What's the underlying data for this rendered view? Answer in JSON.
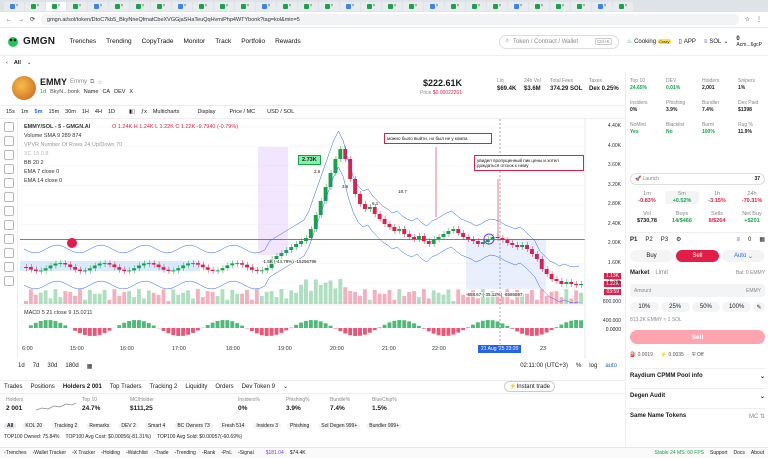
{
  "browser": {
    "url": "gmgn.ai/sol/token/DtoC7kb5_BkyNneQfmatCbeXVGGjaSHaTeuQqHvmiPhp4WTYbonk?tag=kol&min=5",
    "tab_close": "×"
  },
  "nav": {
    "logo": "GMGN",
    "items": [
      "Trenches",
      "Trending",
      "CopyTrade",
      "Monitor",
      "Track",
      "Portfolio",
      "Rewards"
    ],
    "search_placeholder": "Token / Contract / Wallet",
    "search_shortcut": "Ctrl+K",
    "cooking": "Cooking",
    "cooking_badge": "Crazy",
    "app": "APP",
    "chain": "SOL",
    "balance": "0",
    "wallet": "Acm...6gcP"
  },
  "subnav": {
    "filter": "All"
  },
  "token": {
    "symbol": "EMMY",
    "name": "Emmy",
    "age": "1d",
    "creator": "BkyN...bonk",
    "links": [
      "Name",
      "CA",
      "DEV",
      "X"
    ],
    "price_usd": "$222.61K",
    "price_label": "Price",
    "price_sol": "$0.00022261",
    "liq_label": "Liq",
    "liq": "$69.4K",
    "vol_label": "24h Vol",
    "vol": "$3.6M",
    "fees_label": "Total Fees",
    "fees": "374.29 SOL",
    "taxes_label": "Taxes",
    "taxes": "Dex 0.25%"
  },
  "toolbar": {
    "timeframes": [
      "15s",
      "1m",
      "5m",
      "15m",
      "30m",
      "1H",
      "4H",
      "1D"
    ],
    "multicharts": "Multicharts",
    "display": "Display",
    "pricemc": "Price / MC",
    "usdsol": "USD / SOL"
  },
  "chart_info": {
    "title": "EMMY/SOL - 5 - GMGN.AI",
    "ohlc": "O 1.24K  H 1.24K  L 1.22K  C 1.22K  -9.7940 (-0.79%)",
    "indicators": [
      "Volume SMA 9  289  874",
      "VPVR Number Of Rows 24 Up/Down 70",
      "XC 15 0.8",
      "BB 20 2",
      "EMA 7 close 0",
      "EMA 14 close 0"
    ],
    "macd": "MACD 5 21 close 9  15.0211",
    "annot_high": "2.73K",
    "annot_1": "можно было выйти, но был не у компа",
    "annot_2": "увидел пропущенный пик цены и хотел дождаться отскок к нему",
    "m1": "-1.5K (-44.79%) -15256796",
    "m2": "-658.67 (-35.12%) -6586697",
    "small": [
      "3.6",
      "6.1",
      "18.7",
      "2.6"
    ],
    "current_tag": "1.13K",
    "current_time": "1.22K",
    "timer": "03:59",
    "crosshair_time": "21 Aug '25   23:20",
    "yticks": [
      "4.40K",
      "4.00K",
      "3.60K",
      "3.20K",
      "2.80K",
      "2.40K",
      "2.00K",
      "1.60K",
      "1.20K",
      "800.000",
      "400.000"
    ],
    "macd_ticks": [
      "0.0000"
    ],
    "xticks": [
      "6:00",
      "15:00",
      "16:00",
      "17:00",
      "18:00",
      "19:00",
      "20:00",
      "21:00",
      "22:00",
      "23"
    ]
  },
  "chart_bottom": {
    "ranges": [
      "1d",
      "7d",
      "30d",
      "180d"
    ],
    "clock": "02:11:00 (UTC+3)",
    "log": "log",
    "pct": "%",
    "auto": "auto"
  },
  "bottom": {
    "tabs": [
      "Trades",
      "Positions",
      "Holders 2 001",
      "Top Traders",
      "Tracking 2",
      "Liquidity",
      "Orders",
      "Dev Token 9"
    ],
    "instant": "Instant trade",
    "stats": [
      {
        "l": "Holders",
        "v": "2 001"
      },
      {
        "l": "Top 10",
        "v": "24.7%"
      },
      {
        "l": "MC/Holder",
        "v": "$111,25"
      },
      {
        "l": "Insiders%",
        "v": "0%"
      },
      {
        "l": "Phishing%",
        "v": "3.9%"
      },
      {
        "l": "Bundle%",
        "v": "7.4%"
      },
      {
        "l": "BlueChip%",
        "v": "1.5%"
      }
    ],
    "tags": [
      "All",
      "KOL 20",
      "Tracking 2",
      "Remarks",
      "DEV 2",
      "Smart 4",
      "BC Owners 73",
      "Fresh 514",
      "Insiders 3",
      "Phishing",
      "Sol Degen 999+",
      "Bundler 999+"
    ],
    "top": [
      "TOP100 Owned: 75.84%",
      "TOP100 Avg Cost: $0.00056(-81.31%)",
      "TOP100 Avg Sold: $0.00057(-60.69%)"
    ]
  },
  "right": {
    "grid": [
      {
        "l": "Top 10",
        "v": "24.65%",
        "c": "green"
      },
      {
        "l": "DEV",
        "v": "0.01%",
        "c": "green"
      },
      {
        "l": "Holders",
        "v": "2,001",
        "c": ""
      },
      {
        "l": "Snipers",
        "v": "1%",
        "c": ""
      },
      {
        "l": "Insiders",
        "v": "0%",
        "c": ""
      },
      {
        "l": "Phishing",
        "v": "3.9%",
        "c": ""
      },
      {
        "l": "Bundler",
        "v": "7.4%",
        "c": ""
      },
      {
        "l": "Dex Paid",
        "v": "$1398",
        "c": ""
      },
      {
        "l": "NoMint",
        "v": "Yes",
        "c": "green"
      },
      {
        "l": "Blacklist",
        "v": "No",
        "c": "green"
      },
      {
        "l": "Burnt",
        "v": "100%",
        "c": "green"
      },
      {
        "l": "Rug %",
        "v": "11.9%",
        "c": ""
      }
    ],
    "launch": "Launch",
    "launch_count": "37",
    "tf": [
      {
        "l": "1m",
        "v": "-0.83%",
        "c": "red"
      },
      {
        "l": "5m",
        "v": "+0.52%",
        "c": "green"
      },
      {
        "l": "1h",
        "v": "-3.15%",
        "c": "red"
      },
      {
        "l": "24h",
        "v": "-70.31%",
        "c": "red"
      }
    ],
    "vol": [
      {
        "l": "Vol",
        "v": "$730,78",
        "c": ""
      },
      {
        "l": "Buys",
        "v": "14/$466",
        "c": "green"
      },
      {
        "l": "Sells",
        "v": "8/$264",
        "c": "red"
      },
      {
        "l": "Net Buy",
        "v": "+$201",
        "c": "green"
      }
    ],
    "presets": [
      "P1",
      "P2",
      "P3"
    ],
    "preset_count": "0",
    "buy": "Buy",
    "sell": "Sell",
    "auto": "Auto",
    "market": "Market",
    "limit": "Limit",
    "bal": "Bal: 0 EMMY",
    "amount": "Amount",
    "unit": "EMMY",
    "pcts": [
      "10%",
      "25%",
      "50%",
      "100%"
    ],
    "est": "813.2K EMMY ≈ 1 SOL",
    "sellbtn": "Sell",
    "fees": [
      "0.0019",
      "0.0035",
      "Off"
    ],
    "accordions": [
      {
        "label": "Raydium CPMM Pool info",
        "chev": "⌄"
      },
      {
        "label": "Degen Audit",
        "chev": "⌄"
      },
      {
        "label": "Same Name Tokens",
        "chev": "MC ⇅"
      }
    ]
  },
  "footer": {
    "items": [
      "Trenches",
      "Wallet Tracker",
      "X Tracker",
      "Holding",
      "Watchlist",
      "Trade",
      "Trending",
      "Rank",
      "PnL",
      "Signal"
    ],
    "sol_price": "$181.04",
    "other": "$74.4K",
    "status": "Stable 24 MS: 60 FPS",
    "tail": [
      "Support",
      "Docs",
      "About"
    ]
  }
}
